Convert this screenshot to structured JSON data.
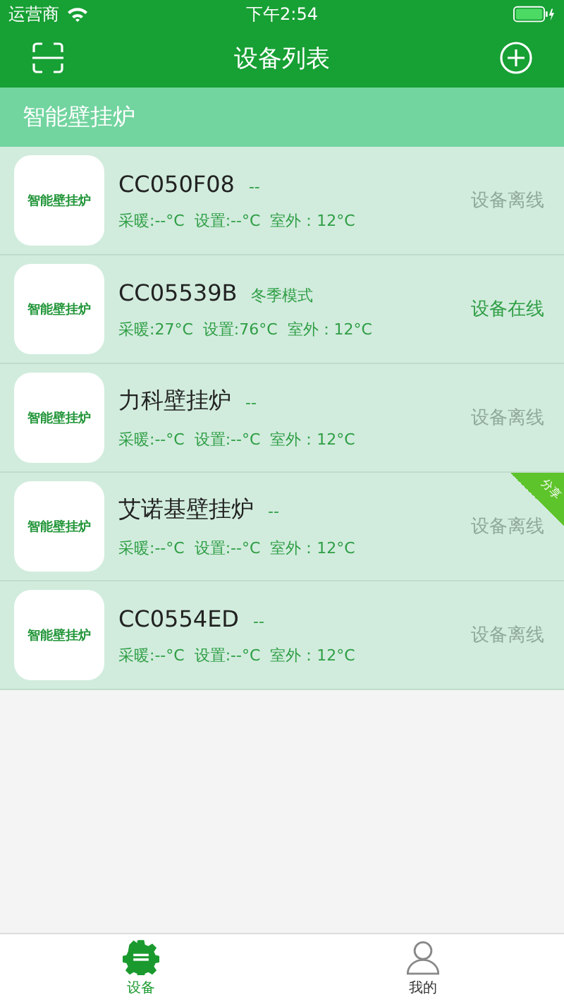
{
  "status_bar": {
    "carrier": "运营商",
    "time": "下午2:54"
  },
  "nav": {
    "title": "设备列表"
  },
  "section": {
    "title": "智能壁挂炉"
  },
  "devices": [
    {
      "logo": "智能壁挂炉",
      "name": "CC050F08",
      "mode": "--",
      "readings": "采暖:--°C  设置:--°C  室外：12°C",
      "status": "设备离线",
      "online": false,
      "shared": false
    },
    {
      "logo": "智能壁挂炉",
      "name": "CC05539B",
      "mode": "冬季模式",
      "readings": "采暖:27°C  设置:76°C  室外：12°C",
      "status": "设备在线",
      "online": true,
      "shared": false
    },
    {
      "logo": "智能壁挂炉",
      "name": "力科壁挂炉",
      "mode": "--",
      "readings": "采暖:--°C  设置:--°C  室外：12°C",
      "status": "设备离线",
      "online": false,
      "shared": false
    },
    {
      "logo": "智能壁挂炉",
      "name": "艾诺基壁挂炉",
      "mode": "--",
      "readings": "采暖:--°C  设置:--°C  室外：12°C",
      "status": "设备离线",
      "online": false,
      "shared": true,
      "share_label": "分享"
    },
    {
      "logo": "智能壁挂炉",
      "name": "CC0554ED",
      "mode": "--",
      "readings": "采暖:--°C  设置:--°C  室外：12°C",
      "status": "设备离线",
      "online": false,
      "shared": false
    }
  ],
  "tabs": [
    {
      "label": "设备",
      "kind": "device",
      "selected": true
    },
    {
      "label": "我的",
      "kind": "profile",
      "selected": false
    }
  ]
}
